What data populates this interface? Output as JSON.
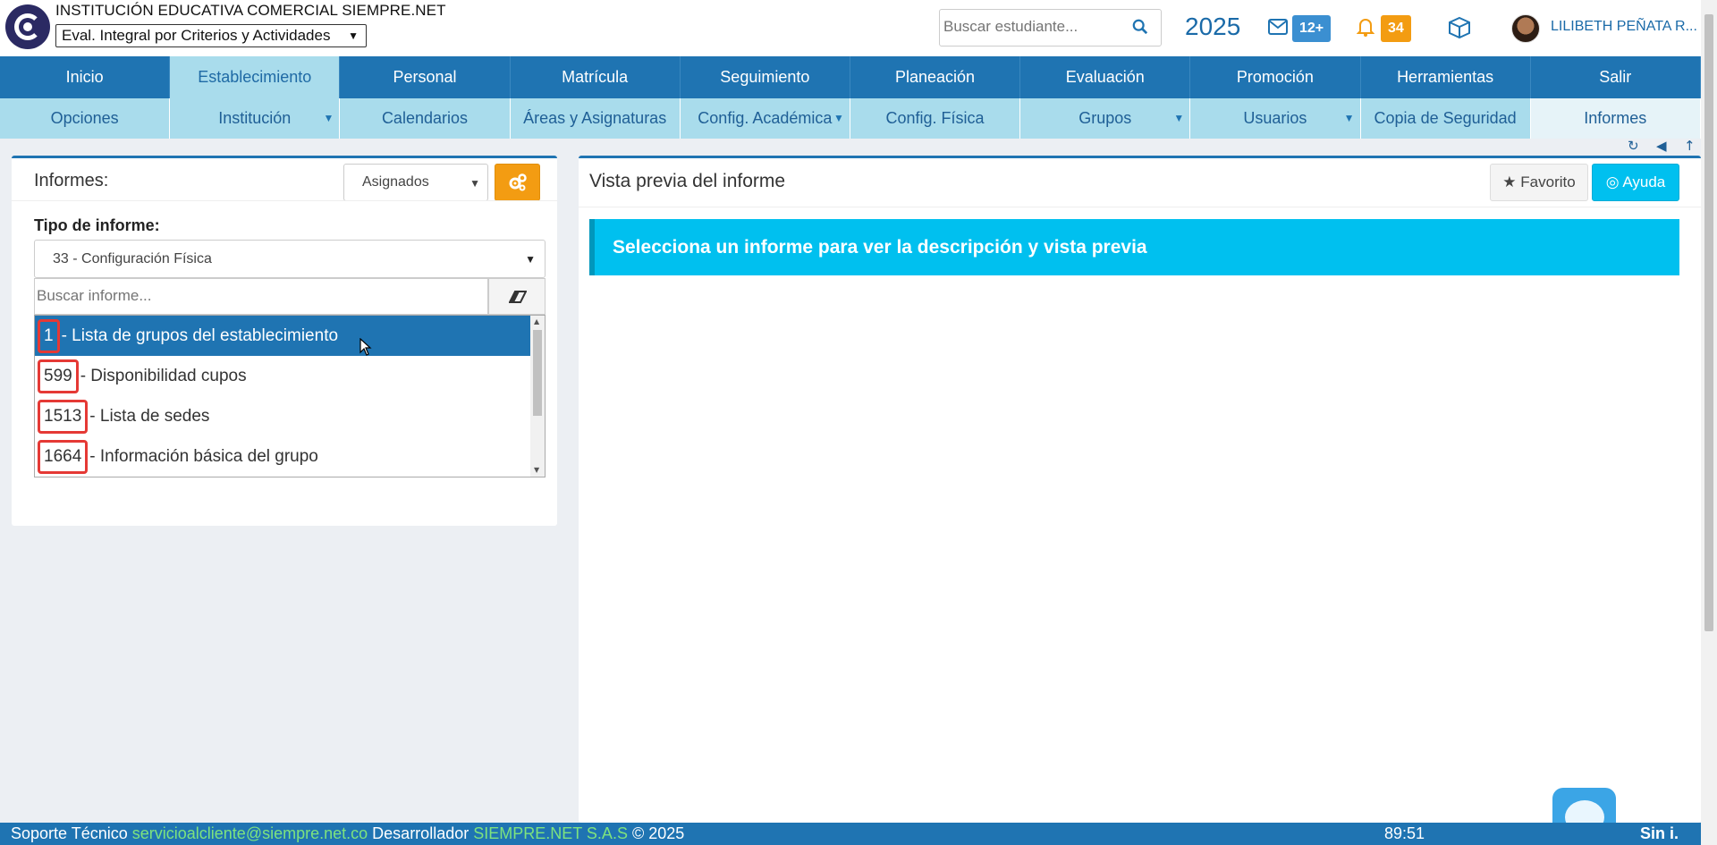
{
  "header": {
    "institution": "INSTITUCIÓN EDUCATIVA COMERCIAL SIEMPRE.NET",
    "eval_select": "Eval. Integral por Criterios y Actividades",
    "search_placeholder": "Buscar estudiante...",
    "year": "2025",
    "mail_badge": "12+",
    "bell_badge": "34",
    "user_name": "LILIBETH PEÑATA R..."
  },
  "nav_main": [
    "Inicio",
    "Establecimiento",
    "Personal",
    "Matrícula",
    "Seguimiento",
    "Planeación",
    "Evaluación",
    "Promoción",
    "Herramientas",
    "Salir"
  ],
  "nav_sub": [
    "Opciones",
    "Institución",
    "Calendarios",
    "Áreas y Asignaturas",
    "Config. Académica",
    "Config. Física",
    "Grupos",
    "Usuarios",
    "Copia de Seguridad",
    "Informes"
  ],
  "left": {
    "title": "Informes:",
    "filter_select": "Asignados",
    "tipo_label": "Tipo de informe:",
    "tipo_value": "33 - Configuración Física",
    "search_placeholder": "Buscar informe...",
    "options": [
      {
        "num": "1",
        "label": "- Lista de grupos del establecimiento"
      },
      {
        "num": "599",
        "label": "- Disponibilidad cupos"
      },
      {
        "num": "1513",
        "label": "- Lista de sedes"
      },
      {
        "num": "1664",
        "label": "- Información básica del grupo"
      }
    ]
  },
  "right": {
    "title": "Vista previa del informe",
    "fav_label": "Favorito",
    "help_label": "Ayuda",
    "alert": "Selecciona un informe para ver la descripción y vista previa"
  },
  "footer": {
    "support_label": "Soporte Técnico",
    "support_email": "servicioalcliente@siempre.net.co",
    "dev_label": "Desarrollador",
    "dev_name": "SIEMPRE.NET S.A.S",
    "copyright": "© 2025",
    "timer": "89:51",
    "brand": "Sin  i."
  },
  "colors": {
    "primary": "#1f74b2",
    "sub_nav": "#a9dcec",
    "accent_orange": "#f39c12",
    "info": "#00c0ef",
    "highlight_red": "#e53935"
  }
}
